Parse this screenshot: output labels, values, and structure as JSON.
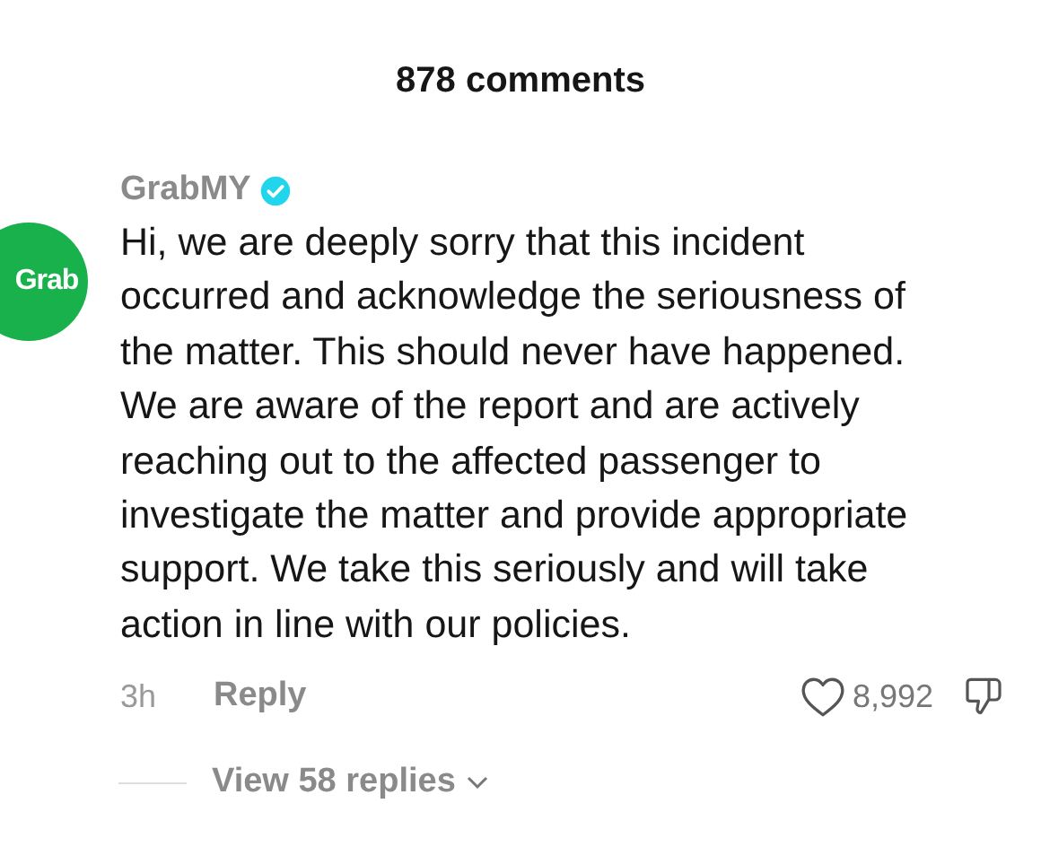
{
  "header": {
    "title": "878 comments"
  },
  "comment": {
    "avatar_text": "Grab",
    "username": "GrabMY",
    "verified": true,
    "lines": [
      "Hi, we are deeply sorry that this incident",
      "occurred and acknowledge the seriousness of",
      "the matter. This should never have happened.",
      "We are aware of the report and are actively",
      "reaching out to the affected passenger to",
      "investigate the matter and provide appropriate",
      "support. We take this seriously and will take",
      "action in line with our policies."
    ],
    "time": "3h",
    "reply_label": "Reply",
    "likes": "8,992",
    "replies_label": "View 58 replies"
  }
}
